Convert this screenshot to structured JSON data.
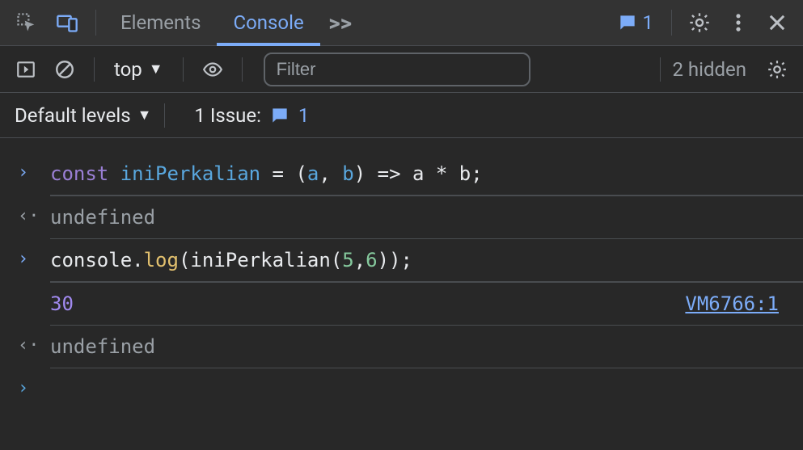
{
  "tabs": {
    "elements": "Elements",
    "console": "Console",
    "more": ">>"
  },
  "issue_badge": "1",
  "toolbar": {
    "context": "top",
    "filter_placeholder": "Filter",
    "hidden_text": "2 hidden"
  },
  "levels": {
    "label": "Default levels",
    "issues_label": "1 Issue:",
    "issues_count": "1"
  },
  "log": {
    "line1": {
      "kw": "const",
      "name": "iniPerkalian",
      "eq": "=",
      "lp": "(",
      "a": "a",
      "comma": ",",
      "b": "b",
      "rp": ")",
      "arrow": "=>",
      "expr_a": "a",
      "star": "*",
      "expr_b": "b",
      "semi": ";"
    },
    "ret1": "undefined",
    "line2": {
      "obj": "console",
      "dot": ".",
      "fn": "log",
      "lp": "(",
      "call": "iniPerkalian",
      "lp2": "(",
      "n1": "5",
      "comma": ",",
      "n2": "6",
      "rp2": ")",
      "rp": ")",
      "semi": ";"
    },
    "out": "30",
    "out_src": "VM6766:1",
    "ret2": "undefined"
  }
}
